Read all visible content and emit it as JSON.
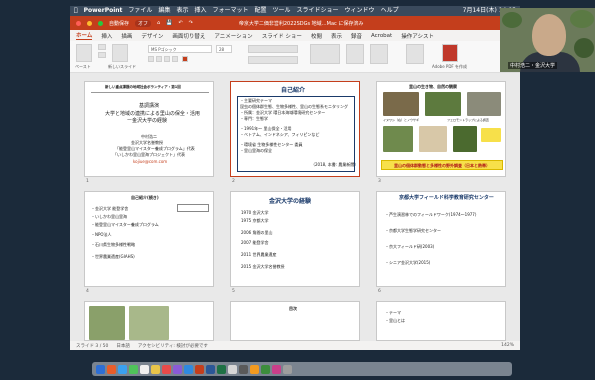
{
  "os_menubar": {
    "app": "PowerPoint",
    "items": [
      "ファイル",
      "編集",
      "表示",
      "挿入",
      "フォーマット",
      "配置",
      "ツール",
      "スライドショー",
      "ウィンドウ",
      "ヘルプ"
    ],
    "clock": "7月14日(木) 14:05"
  },
  "titlebar": {
    "autosave": "自動保存",
    "autosave_state": "オフ",
    "document_title": "帝京大学二価非営利2022SDGs 地域…Mac に保存済み"
  },
  "ribbon": {
    "tabs": [
      "ホーム",
      "挿入",
      "描画",
      "デザイン",
      "画面切り替え",
      "アニメーション",
      "スライド ショー",
      "校閲",
      "表示",
      "録音",
      "Acrobat",
      "操作アシスト"
    ],
    "active_tab": "ホーム",
    "font_name": "MS Pゴシック",
    "font_size": "28",
    "paste_label": "ペースト",
    "new_slide_label": "新しいスライド",
    "share_label": "共有",
    "comment_label": "コメント",
    "acrobat_label": "Adobe PDF を作成"
  },
  "slides": [
    {
      "num": "1",
      "header": "新しい重点課題の地域社会ボランティア・第1回",
      "lines": [
        "基調講演",
        "大学と地域の連携による里山の保全・活用",
        "ー金沢大学の経験",
        "中村浩二",
        "金沢大学名誉教授",
        "「能登里山マイスター養成プログラム」代表",
        "「いしかわ里山里海プロジェクト」代表"
      ],
      "link": "kojiue@com.com"
    },
    {
      "num": "2",
      "title": "自己紹介",
      "lines": [
        "・主要研究テーマ",
        "昆虫の個体群生態、生物多様性、里山の生態系モニタリング",
        "・所属：金沢大学 環日本海域環境研究センター",
        "・専門：生態学",
        "・1991年～ 里山保全・活用",
        "・ベトナム、インドネシア、フィリピンなど",
        "・環境省 生物多様性センター 委員",
        "・里山里海の保全",
        "（2018, 本書: 農業新聞）"
      ]
    },
    {
      "num": "3",
      "title": "里山の生き物、自然の観察",
      "photo_labels": [
        "イヌワシ（右）とノウサギ",
        "フェロモントラップによる調査",
        ""
      ],
      "banner": "里山の個体群動態と多様性の野外調査（日本と熱帯）"
    },
    {
      "num": "4",
      "title": "自己紹介(続き)",
      "lines": [
        "・金沢大学 能登学舎",
        "・いしかわ里山里海",
        "・能登里山マイスター養成プログラム",
        "・NPO法人",
        "・石川県生物多様性戦略",
        "・世界農業遺産(GIAHS)"
      ]
    },
    {
      "num": "5",
      "title": "金沢大学の経験",
      "lines": [
        "1970 金沢大学",
        "1975 京都大学",
        "2006 角間の里山",
        "2007 能登学舎",
        "2011 世界農業遺産",
        "2015 金沢大学名誉教授"
      ]
    },
    {
      "num": "6",
      "title": "京都大学フィールド科学教育研究センター",
      "lines": [
        "・芦生演習林でのフィールドワーク(1974～1977)",
        "・京都大学生態学研究センター",
        "・京大フィールド研(2003)",
        "・シニア金沢大学(2015)"
      ]
    },
    {
      "num": "7",
      "lines": []
    },
    {
      "num": "8",
      "title": "目次",
      "lines": []
    },
    {
      "num": "9",
      "lines": [
        "・テーマ",
        "・里山とは"
      ]
    }
  ],
  "statusbar": {
    "slide_info": "スライド 3 / 50",
    "language": "日本語",
    "accessibility": "アクセシビリティ: 検討が必要です",
    "zoom": "142%"
  },
  "video": {
    "participant": "中村浩二・金沢大学"
  },
  "colors": {
    "accent": "#c43e1c",
    "banner": "#f7e04a"
  }
}
